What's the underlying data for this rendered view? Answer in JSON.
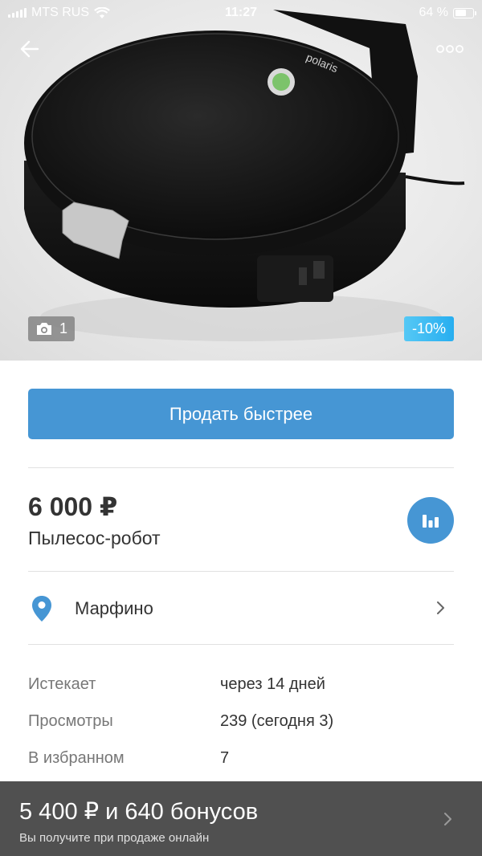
{
  "status_bar": {
    "carrier": "MTS RUS",
    "time": "11:27",
    "battery": "64 %",
    "battery_level": 0.64
  },
  "hero": {
    "photo_count": "1",
    "discount": "-10%",
    "brand_on_device": "polaris"
  },
  "actions": {
    "sell_faster": "Продать быстрее"
  },
  "listing": {
    "price": "6 000 ₽",
    "title": "Пылесос-робот",
    "location": "Марфино"
  },
  "info": [
    {
      "label": "Истекает",
      "value": "через 14 дней"
    },
    {
      "label": "Просмотры",
      "value": "239 (сегодня 3)"
    },
    {
      "label": "В избранном",
      "value": "7"
    }
  ],
  "bottom_bar": {
    "title": "5 400 ₽ и 640 бонусов",
    "subtitle": "Вы получите при продаже онлайн"
  },
  "colors": {
    "accent": "#4696d4",
    "discount_badge": "#27aef0",
    "bottom_bar": "#505050"
  },
  "icons": [
    "wifi-icon",
    "back-arrow-icon",
    "more-icon",
    "camera-icon",
    "bar-chart-icon",
    "location-pin-icon",
    "chevron-right-icon"
  ]
}
